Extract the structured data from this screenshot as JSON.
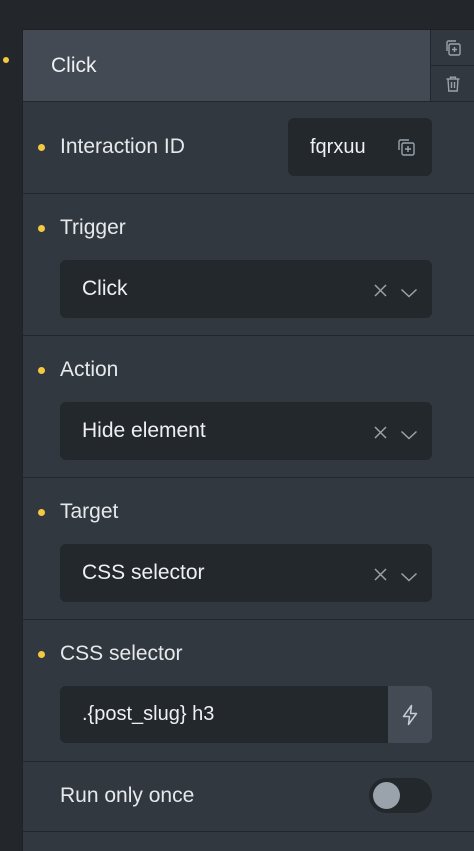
{
  "header": {
    "title": "Click",
    "duplicate_icon": "duplicate-icon",
    "delete_icon": "trash-icon"
  },
  "interaction_id": {
    "label": "Interaction ID",
    "value": "fqrxuu",
    "copy_icon": "copy-icon"
  },
  "trigger": {
    "label": "Trigger",
    "value": "Click"
  },
  "action": {
    "label": "Action",
    "value": "Hide element"
  },
  "target": {
    "label": "Target",
    "value": "CSS selector"
  },
  "css_selector": {
    "label": "CSS selector",
    "value": ".{post_slug} h3",
    "dynamic_icon": "bolt-icon"
  },
  "run_once": {
    "label": "Run only once",
    "enabled": false
  },
  "colors": {
    "indicator": "#f5c842",
    "panel": "#32383f",
    "input": "#23282d",
    "header": "#434a53"
  }
}
